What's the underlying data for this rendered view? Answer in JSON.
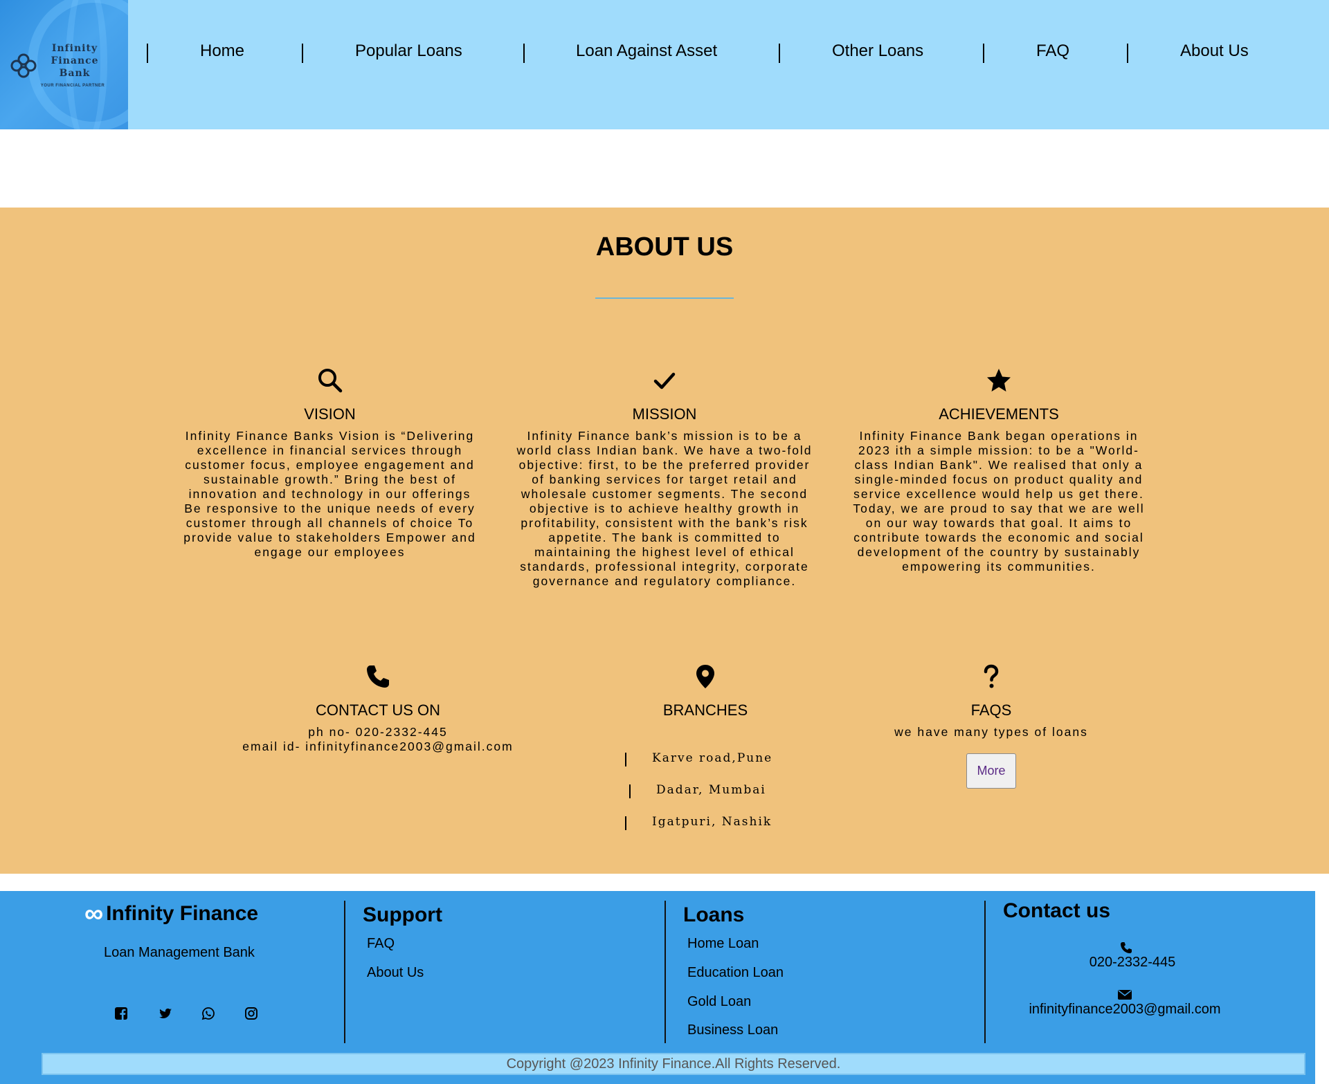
{
  "logo": {
    "name_lines": [
      "Infinity",
      "Finance",
      "Bank"
    ],
    "tagline": "YOUR FINANCIAL PARTNER"
  },
  "nav": [
    "Home",
    "Popular Loans",
    "Loan Against Asset",
    "Other Loans",
    "FAQ",
    "About Us"
  ],
  "about": {
    "title": "ABOUT US",
    "cards": [
      {
        "icon": "search-icon",
        "title": "VISION",
        "text": "Infinity Finance Banks Vision is “Delivering excellence in financial services through customer focus, employee engagement and sustainable growth.” Bring the best of innovation and technology in our offerings Be responsive to the unique needs of every customer through all channels of choice To provide value to stakeholders Empower and engage our employees"
      },
      {
        "icon": "check-icon",
        "title": "MISSION",
        "text": "Infinity Finance bank’s mission is to be a world class Indian bank. We have a two-fold objective: first, to be the preferred provider of banking services for target retail and wholesale customer segments. The second objective is to achieve healthy growth in profitability, consistent with the bank’s risk appetite. The bank is committed to maintaining the highest level of ethical standards, professional integrity, corporate governance and regulatory compliance."
      },
      {
        "icon": "star-icon",
        "title": "ACHIEVEMENTS",
        "text": "Infinity Finance Bank began operations in 2023 ith a simple mission: to be a \"World-class Indian Bank\". We realised that only a single-minded focus on product quality and service excellence would help us get there. Today, we are proud to say that we are well on our way towards that goal. It aims to contribute towards the economic and social development of the country by sustainably empowering its communities."
      }
    ],
    "contact": {
      "icon": "phone-icon",
      "title": "CONTACT US ON",
      "phone": "ph no- 020-2332-445",
      "email": "email id- infinityfinance2003@gmail.com"
    },
    "branches": {
      "icon": "location-pin-icon",
      "title": "BRANCHES",
      "items": [
        "Karve road,Pune",
        "Dadar, Mumbai",
        "Igatpuri, Nashik"
      ]
    },
    "faqs": {
      "icon": "question-icon",
      "title": "FAQS",
      "text": "we have many types of loans",
      "button": "More"
    }
  },
  "footer": {
    "brand": "Infinity Finance",
    "subtitle": "Loan Management Bank",
    "social": [
      "facebook-icon",
      "twitter-icon",
      "whatsapp-icon",
      "instagram-icon"
    ],
    "support": {
      "title": "Support",
      "links": [
        "FAQ",
        "About Us"
      ]
    },
    "loans": {
      "title": "Loans",
      "links": [
        "Home Loan",
        "Education Loan",
        "Gold Loan",
        "Business Loan"
      ]
    },
    "contact": {
      "title": "Contact us",
      "phone": "020-2332-445",
      "email": "infinityfinance2003@gmail.com"
    },
    "copyright": "Copyright @2023 Infinity Finance.All Rights Reserved."
  }
}
